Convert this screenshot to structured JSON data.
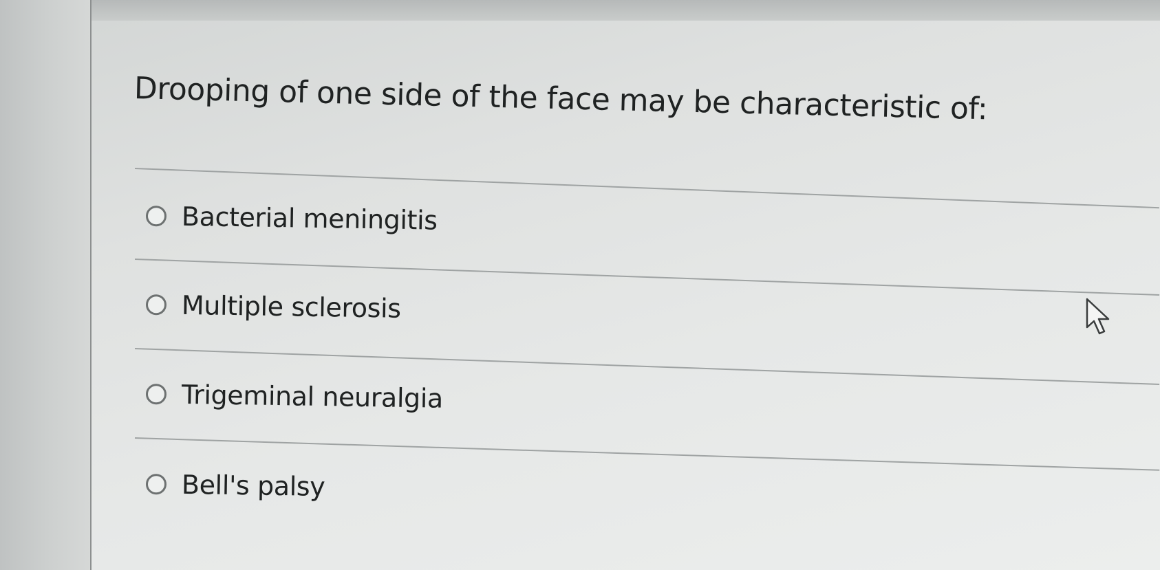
{
  "question": {
    "text": "Drooping of one side of the face may be characteristic of:"
  },
  "options": [
    {
      "label": "Bacterial meningitis",
      "selected": false
    },
    {
      "label": "Multiple sclerosis",
      "selected": false
    },
    {
      "label": "Trigeminal neuralgia",
      "selected": false
    },
    {
      "label": "Bell's palsy",
      "selected": false
    }
  ],
  "icons": {
    "radio": "radio-unselected-icon",
    "cursor": "mouse-pointer-icon"
  },
  "colors": {
    "text": "#1f2222",
    "radio_border": "#6d7171",
    "divider": "#9fa3a3",
    "panel": "#e4e6e5"
  }
}
